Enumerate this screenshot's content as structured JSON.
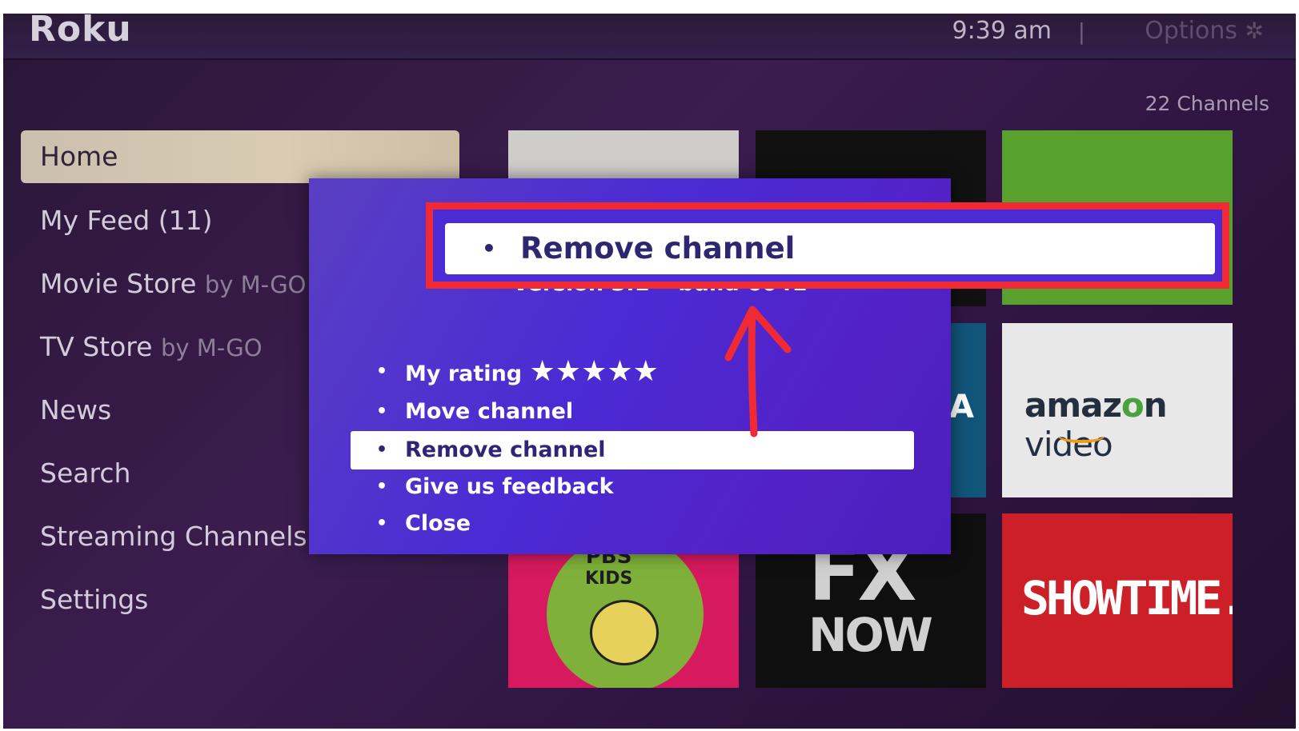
{
  "header": {
    "logo": "Roku",
    "time": "9:39 am",
    "separator": "|",
    "options_label": "Options",
    "options_icon": "✲"
  },
  "channel_count": "22 Channels",
  "sidebar": {
    "items": [
      {
        "label": "Home",
        "sub": ""
      },
      {
        "label": "My Feed (11)",
        "sub": ""
      },
      {
        "label": "Movie Store",
        "sub": "by M-GO"
      },
      {
        "label": "TV Store",
        "sub": "by M-GO"
      },
      {
        "label": "News",
        "sub": ""
      },
      {
        "label": "Search",
        "sub": ""
      },
      {
        "label": "Streaming Channels",
        "sub": ""
      },
      {
        "label": "Settings",
        "sub": ""
      }
    ]
  },
  "tiles": {
    "amazon": {
      "brand": "amaz",
      "o": "o",
      "n": "n",
      "video": " video"
    },
    "pbs": {
      "line1": "PBS",
      "line2": "KIDS"
    },
    "fx": {
      "line1": "FX",
      "line2": "NOW"
    },
    "showtime": {
      "label": "SHOWTIME."
    },
    "partial": {
      "label": "A"
    }
  },
  "dialog": {
    "version": "Version 3.1 • build 6041",
    "bullet": "•",
    "menu": [
      {
        "label": "My rating",
        "stars": "★★★★★"
      },
      {
        "label": "Move channel"
      },
      {
        "label": "Remove channel"
      },
      {
        "label": "Give us feedback"
      },
      {
        "label": "Close"
      }
    ]
  },
  "callout": {
    "label": "Remove channel"
  },
  "colors": {
    "highlight_border": "#ef2a35",
    "dialog_bg": "#4a2bd4",
    "arrow": "#ef2a35"
  }
}
